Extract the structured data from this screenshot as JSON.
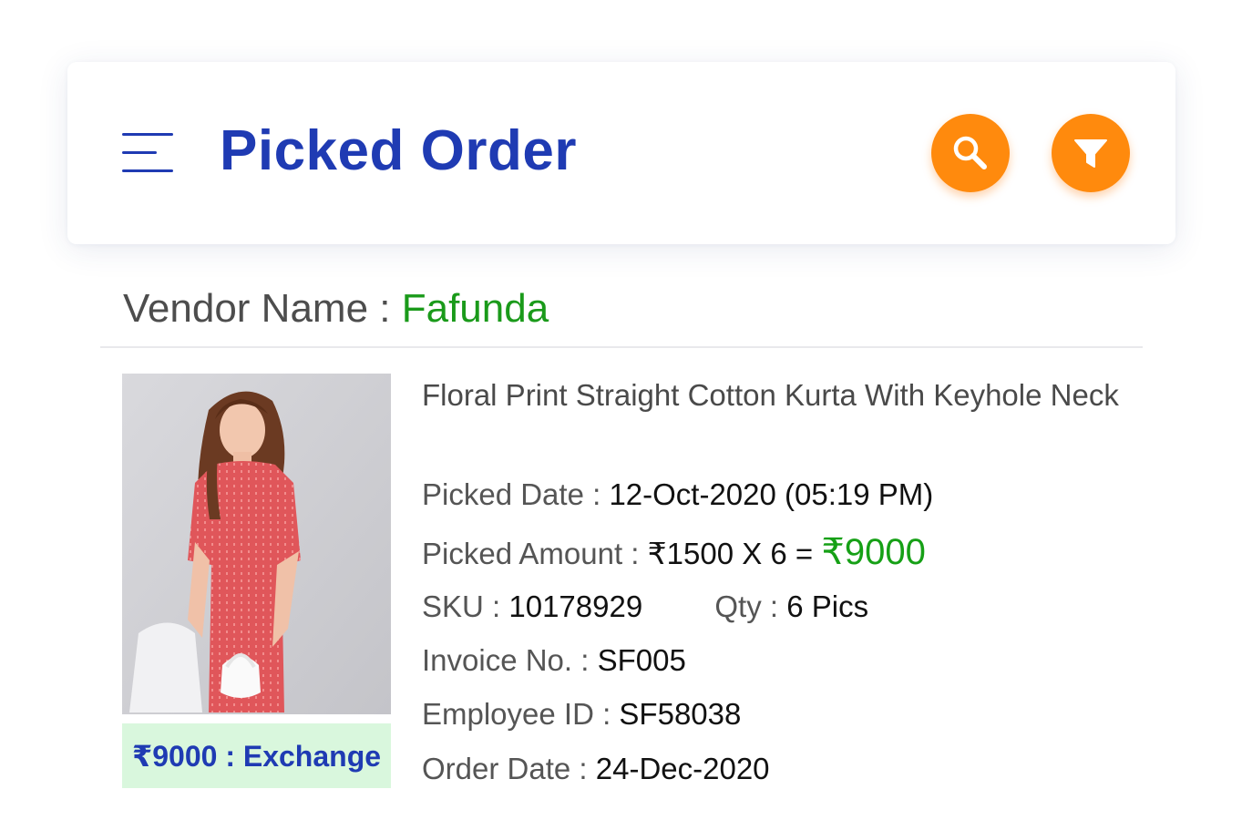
{
  "header": {
    "title": "Picked Order",
    "menu_icon": "hamburger-menu-icon",
    "search_icon": "search-icon",
    "filter_icon": "filter-icon",
    "accent_color": "#1f3bb3",
    "button_color": "#ff8a0d"
  },
  "vendor": {
    "label": "Vendor Name :",
    "name": "Fafunda",
    "name_color": "#1a9a1a"
  },
  "order": {
    "product_name": "Floral Print Straight Cotton Kurta With Keyhole Neck",
    "badge": "₹9000 : Exchange",
    "badge_bg": "#d9f7dd",
    "picked_date_label": "Picked Date :",
    "picked_date": "12-Oct-2020 (05:19 PM)",
    "picked_amount_label": "Picked Amount :",
    "picked_amount_calc": "₹1500 X 6 =",
    "picked_amount_total": "₹9000",
    "sku_label": "SKU :",
    "sku": "10178929",
    "qty_label": "Qty :",
    "qty": "6 Pics",
    "invoice_label": "Invoice No. :",
    "invoice": "SF005",
    "employee_label": "Employee ID :",
    "employee": "SF58038",
    "order_date_label": "Order Date :",
    "order_date": "24-Dec-2020"
  }
}
